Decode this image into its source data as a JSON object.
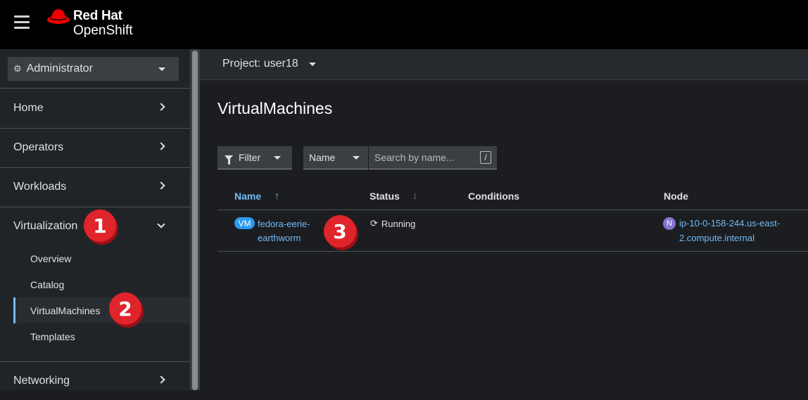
{
  "masthead": {
    "brand_line1": "Red Hat",
    "brand_line2": "OpenShift"
  },
  "sidebar": {
    "perspective": "Administrator",
    "items": [
      {
        "label": "Home"
      },
      {
        "label": "Operators"
      },
      {
        "label": "Workloads"
      },
      {
        "label": "Virtualization",
        "expanded": true
      },
      {
        "label": "Networking"
      }
    ],
    "virtualization_sub": [
      {
        "label": "Overview"
      },
      {
        "label": "Catalog"
      },
      {
        "label": "VirtualMachines",
        "active": true
      },
      {
        "label": "Templates"
      }
    ]
  },
  "content": {
    "project_label": "Project: user18",
    "page_title": "VirtualMachines",
    "filter_label": "Filter",
    "name_select": "Name",
    "search_placeholder": "Search by name...",
    "search_shortcut": "/",
    "columns": [
      "Name",
      "Status",
      "Conditions",
      "Node"
    ],
    "rows": [
      {
        "badge": "VM",
        "name": "fedora-eerie-earthworm",
        "status": "Running",
        "conditions": "",
        "node_badge": "N",
        "node": "ip-10-0-158-244.us-east-2.compute.internal"
      }
    ]
  },
  "annotations": [
    "1",
    "2",
    "3"
  ],
  "colors": {
    "accent": "#73bcf7",
    "callout": "#e0242b",
    "brand_red": "#ee0000",
    "node_badge": "#8476d1",
    "vm_badge": "#2b9af3"
  }
}
